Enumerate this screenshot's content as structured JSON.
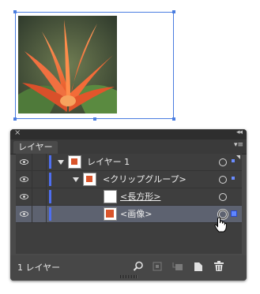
{
  "panel": {
    "close_symbol": "×",
    "collapse_symbol": "◂◂",
    "menu_symbol": "▾≡",
    "tab_label": "レイヤー"
  },
  "layers": [
    {
      "label": "レイヤー 1",
      "expanded": true,
      "level": 0
    },
    {
      "label": "<クリップグループ>",
      "expanded": true,
      "level": 1
    },
    {
      "label": "<長方形>",
      "level": 2
    },
    {
      "label": "<画像>",
      "level": 2,
      "selected": true
    }
  ],
  "footer": {
    "layer_count": "1 レイヤー",
    "icons": [
      "search-icon",
      "clipping-mask-icon",
      "new-sublayer-icon",
      "new-layer-icon",
      "trash-icon"
    ]
  },
  "colors": {
    "selection_blue": "#4a7de0",
    "layer_color": "#4f6ff0",
    "panel_bg": "#4a4a4a",
    "selected_row": "#5d6270"
  }
}
